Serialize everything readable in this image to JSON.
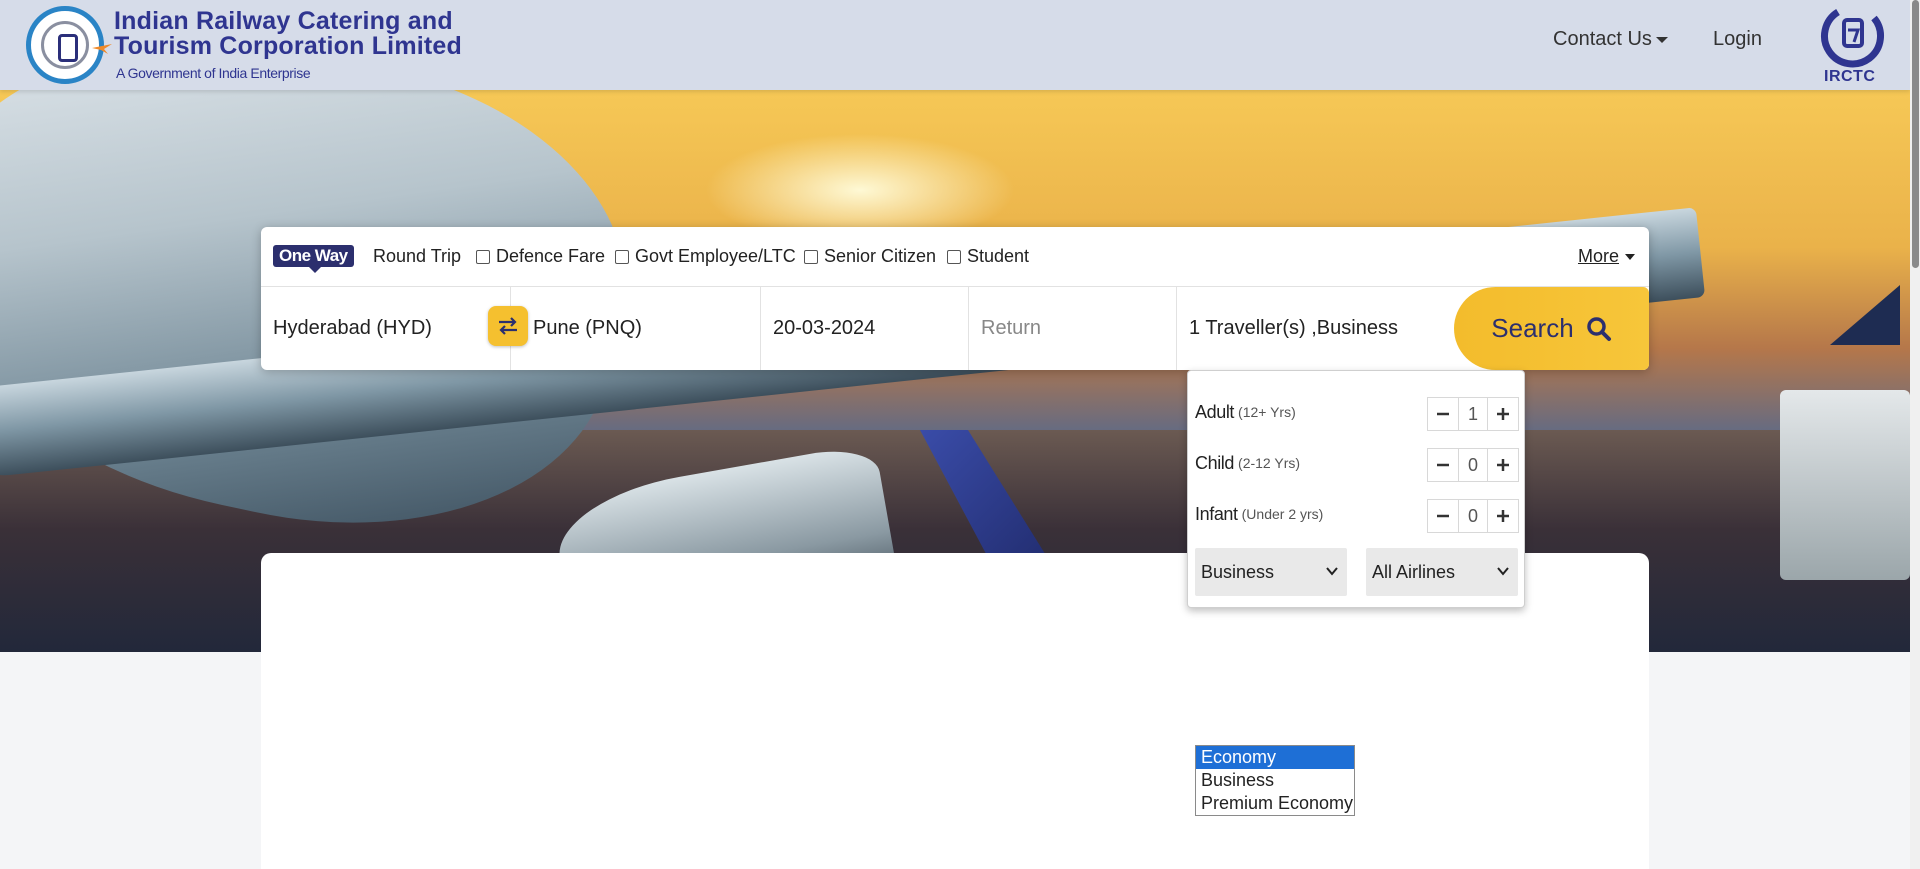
{
  "header": {
    "brand_line1": "Indian Railway Catering and",
    "brand_line2": "Tourism Corporation Limited",
    "brand_sub": "A Government of India Enterprise",
    "nav_contact": "Contact Us",
    "nav_login": "Login",
    "irctc_logo_text": "IRCTC"
  },
  "search": {
    "trip_types": {
      "one_way": "One Way",
      "round_trip": "Round Trip"
    },
    "options": {
      "defence": "Defence Fare",
      "govt": "Govt Employee/LTC",
      "senior": "Senior Citizen",
      "student": "Student"
    },
    "more_label": "More",
    "from": "Hyderabad (HYD)",
    "to": "Pune (PNQ)",
    "depart_date": "20-03-2024",
    "return_placeholder": "Return",
    "travellers_summary": "1  Traveller(s) ,Business",
    "search_label": "Search"
  },
  "travellers": {
    "adult": {
      "label": "Adult",
      "sub": "(12+ Yrs)",
      "value": "1"
    },
    "child": {
      "label": "Child",
      "sub": "(2-12 Yrs)",
      "value": "0"
    },
    "infant": {
      "label": "Infant",
      "sub": "(Under 2 yrs)",
      "value": "0"
    },
    "class_selected": "Business",
    "airline_selected": "All Airlines"
  },
  "class_options": [
    "Economy",
    "Business",
    "Premium Economy"
  ],
  "colors": {
    "brand_navy": "#2c2f6e",
    "accent_yellow": "#f5c02f",
    "header_bg": "#d6dce9",
    "highlight_blue": "#1e6fd6"
  }
}
